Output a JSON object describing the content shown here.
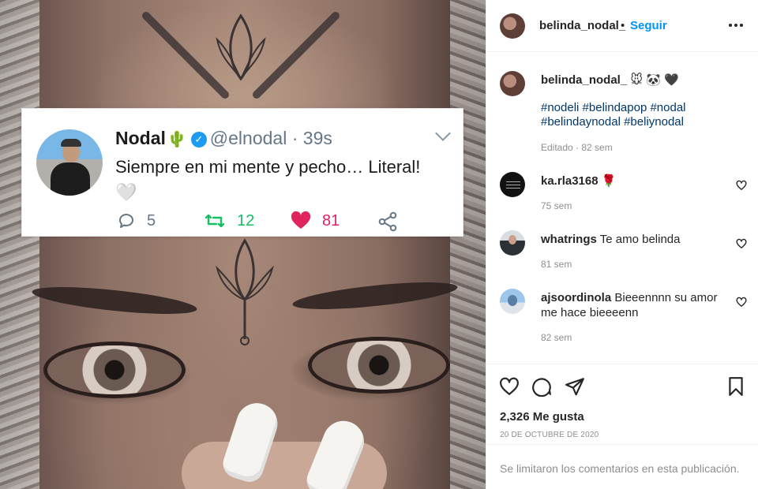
{
  "tweet": {
    "name": "Nodal",
    "name_emoji": "🌵",
    "handle": "@elnodal",
    "separator": "·",
    "time": "39s",
    "text": "Siempre en mi mente y pecho… Literal!",
    "text_emoji": "🤍",
    "replies": "5",
    "retweets": "12",
    "likes": "81",
    "colors": {
      "retweet": "#17bf63",
      "like": "#e0245e",
      "verified": "#1d9bf0"
    }
  },
  "header": {
    "username": "belinda_nodal_",
    "dot": "•",
    "follow_label": "Seguir"
  },
  "caption": {
    "username": "belinda_nodal_",
    "emojis": "🐭 🐼 🖤",
    "hashtags": "#nodeli #belindapop #nodal #belindaynodal #beliynodal",
    "meta": "Editado · 82 sem"
  },
  "comments": [
    {
      "username": "ka.rla3168",
      "text": "🌹",
      "time": "75 sem"
    },
    {
      "username": "whatrings",
      "text": "Te amo belinda",
      "time": "81 sem"
    },
    {
      "username": "ajsoordinola",
      "text": "Bieeennnn su amor me hace bieeeenn",
      "time": "82 sem"
    }
  ],
  "footer": {
    "likes_label": "2,326 Me gusta",
    "date": "20 DE OCTUBRE DE 2020",
    "comments_limited": "Se limitaron los comentarios en esta publicación."
  },
  "icons": [
    "more-options-icon",
    "heart-icon",
    "comment-icon",
    "share-icon",
    "bookmark-icon",
    "verified-icon",
    "reply-icon",
    "retweet-icon",
    "share-node-icon",
    "chevron-down-icon"
  ],
  "accent_color": "#0095f6"
}
